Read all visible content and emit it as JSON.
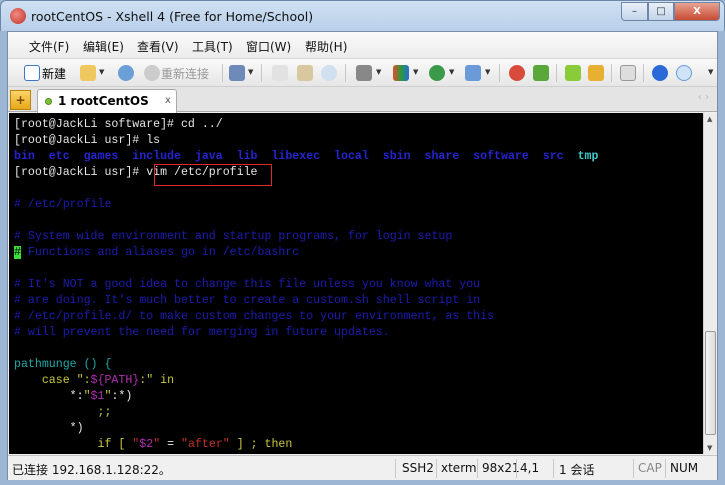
{
  "window": {
    "title": "rootCentOS - Xshell 4 (Free for Home/School)",
    "minimize": "–",
    "maximize": "□",
    "close": "X"
  },
  "menu": [
    "文件(F)",
    "编辑(E)",
    "查看(V)",
    "工具(T)",
    "窗口(W)",
    "帮助(H)"
  ],
  "toolbar": {
    "new_label": "新建",
    "reconnect_label": "重新连接"
  },
  "tab": {
    "label": "1 rootCentOS",
    "close": "x",
    "new": "+",
    "nav": "‹ ›"
  },
  "terminal": {
    "lines": [
      [
        {
          "t": "[root@JackLi software]# cd ../",
          "c": "#e6e6e6"
        }
      ],
      [
        {
          "t": "[root@JackLi usr]# ls",
          "c": "#e6e6e6"
        }
      ],
      [
        {
          "t": "bin  etc  games  include  java  lib  libexec  local  sbin  share  software  src  ",
          "c": "#2424d0",
          "b": true
        },
        {
          "t": "tmp",
          "c": "#3fc8c8",
          "b": true
        }
      ],
      [
        {
          "t": "[root@JackLi usr]# vim /etc/profile",
          "c": "#e6e6e6"
        }
      ],
      [],
      [
        {
          "t": "# /etc/profile",
          "c": "#1c1cb0"
        }
      ],
      [],
      [
        {
          "t": "# System wide environment and startup programs, for login setup",
          "c": "#1c1cb0"
        }
      ],
      [
        {
          "t": "#",
          "c": "#000",
          "bg": "#3ae03a"
        },
        {
          "t": " Functions and aliases go in /etc/bashrc",
          "c": "#1c1cb0"
        }
      ],
      [],
      [
        {
          "t": "# It's NOT a good idea to change this file unless you know what you",
          "c": "#1c1cb0"
        }
      ],
      [
        {
          "t": "# are doing. It's much better to create a custom.sh shell script in",
          "c": "#1c1cb0"
        }
      ],
      [
        {
          "t": "# /etc/profile.d/ to make custom changes to your environment, as this",
          "c": "#1c1cb0"
        }
      ],
      [
        {
          "t": "# will prevent the need for merging in future updates.",
          "c": "#1c1cb0"
        }
      ],
      [],
      [
        {
          "t": "pathmunge () {",
          "c": "#20a8a8"
        }
      ],
      [
        {
          "t": "    case ",
          "c": "#c8c840"
        },
        {
          "t": "\":",
          "c": "#c8c840"
        },
        {
          "t": "${PATH}",
          "c": "#b030b0"
        },
        {
          "t": ":\"",
          "c": "#c8c840"
        },
        {
          "t": " in",
          "c": "#c8c840"
        }
      ],
      [
        {
          "t": "        *:",
          "c": "#e6e6e6"
        },
        {
          "t": "\"",
          "c": "#c8c840"
        },
        {
          "t": "$1",
          "c": "#b030b0"
        },
        {
          "t": "\"",
          "c": "#c8c840"
        },
        {
          "t": ":*)",
          "c": "#e6e6e6"
        }
      ],
      [
        {
          "t": "            ;;",
          "c": "#c8c840"
        }
      ],
      [
        {
          "t": "        *)",
          "c": "#e6e6e6"
        }
      ],
      [
        {
          "t": "            if ",
          "c": "#c8c840"
        },
        {
          "t": "[ ",
          "c": "#c8c840"
        },
        {
          "t": "\"",
          "c": "#c03030"
        },
        {
          "t": "$2",
          "c": "#b030b0"
        },
        {
          "t": "\"",
          "c": "#c03030"
        },
        {
          "t": " = ",
          "c": "#e6e6e6"
        },
        {
          "t": "\"after\"",
          "c": "#c03030"
        },
        {
          "t": " ] ; then",
          "c": "#c8c840"
        }
      ]
    ]
  },
  "status": {
    "connection": "已连接 192.168.1.128:22。",
    "protocol": "SSH2",
    "term": "xterm",
    "size": "98x21",
    "cursor": "4,1",
    "sessions": "1 会话",
    "cap": "CAP",
    "num": "NUM"
  }
}
